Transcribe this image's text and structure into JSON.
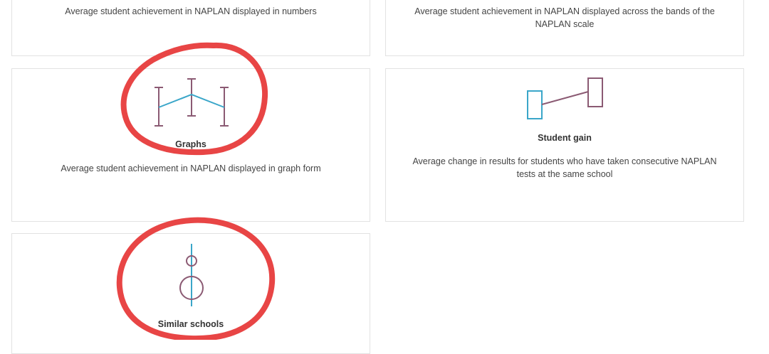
{
  "cards": {
    "numbers": {
      "description": "Average student achievement in NAPLAN displayed in numbers"
    },
    "bands": {
      "description": "Average student achievement in NAPLAN displayed across the bands of the NAPLAN scale"
    },
    "graphs": {
      "title": "Graphs",
      "description": "Average student achievement in NAPLAN displayed in graph form",
      "icon": "graphs-icon"
    },
    "student_gain": {
      "title": "Student gain",
      "description": "Average change in results for students who have taken consecutive NAPLAN tests at the same school",
      "icon": "student-gain-icon"
    },
    "similar_schools": {
      "title": "Similar schools",
      "icon": "similar-schools-icon"
    }
  },
  "colors": {
    "icon_purple": "#8b5a73",
    "icon_blue": "#3aa6c9",
    "annotation_red": "#e84545",
    "card_border": "#e2e2e2"
  }
}
